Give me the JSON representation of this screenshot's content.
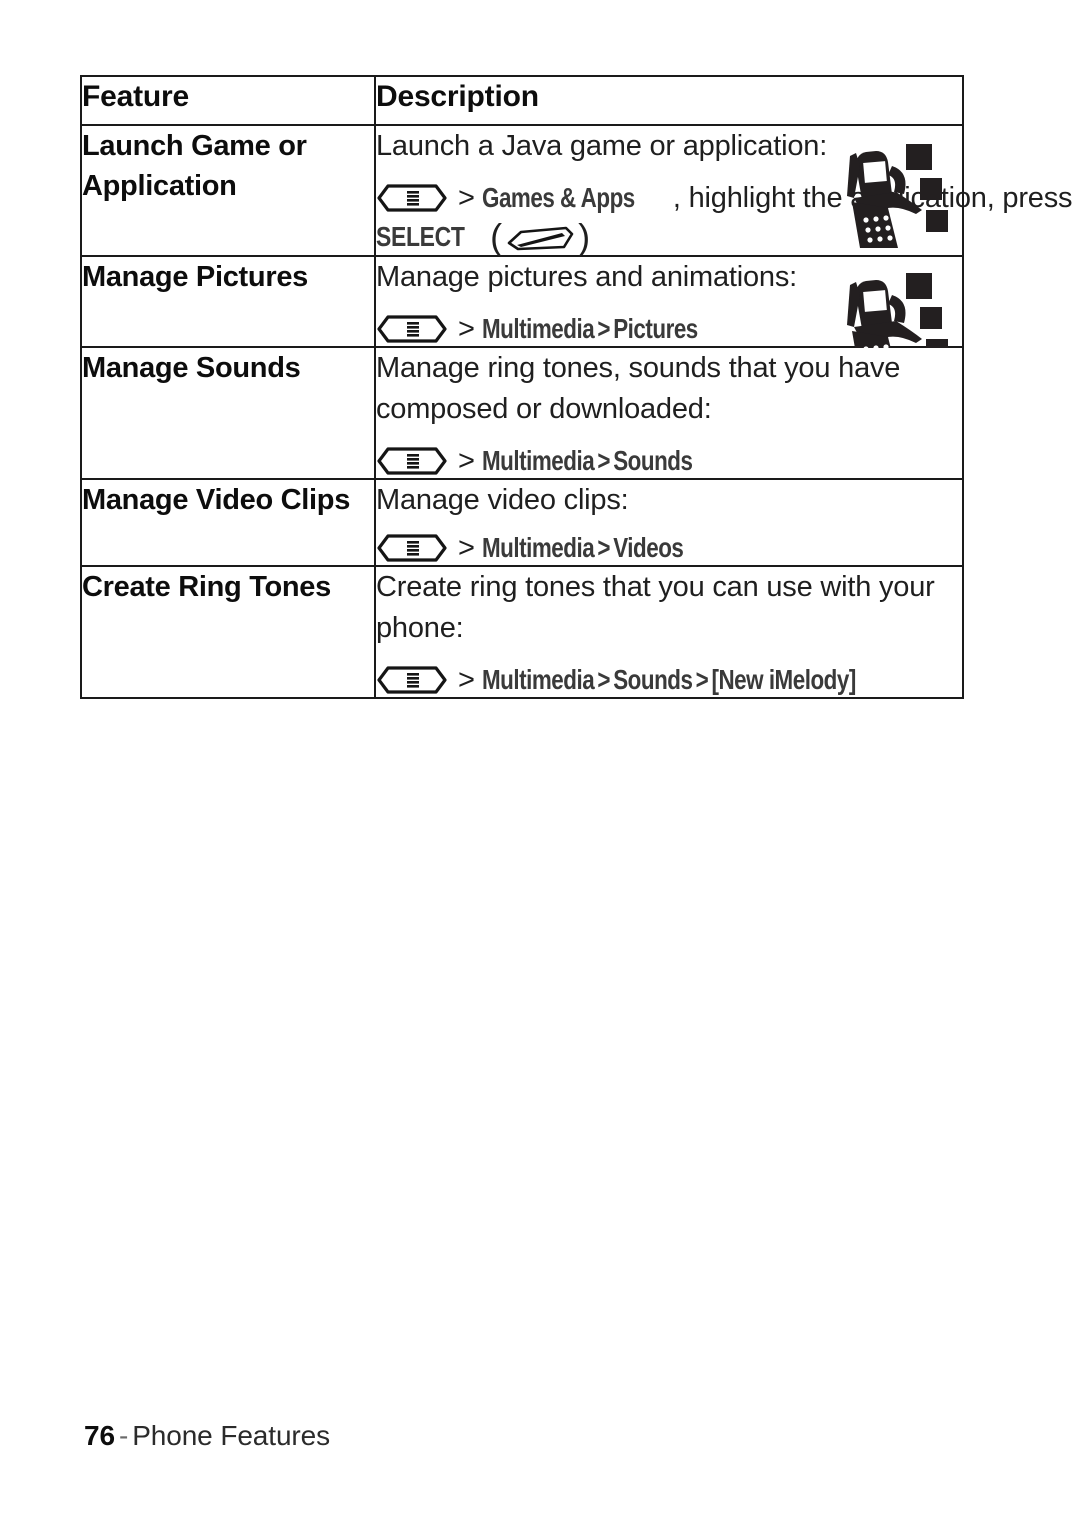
{
  "document": {
    "table": {
      "columns": [
        {
          "header": "Feature"
        },
        {
          "header": "Description"
        }
      ],
      "rows": [
        {
          "feature": "Launch Game or Application",
          "description": "Launch a Java game or application:",
          "nav": {
            "key_icon": "menu-key-icon",
            "separator": ">",
            "path": [
              "Games & Apps"
            ],
            "trailing_text": ", highlight the application, press",
            "press_label": "SELECT",
            "press_key_icon": "soft-key-icon"
          },
          "media_icon": "multimedia-phone-icon"
        },
        {
          "feature": "Manage Pictures",
          "description": "Manage pictures and animations:",
          "nav": {
            "key_icon": "menu-key-icon",
            "separator": ">",
            "path": [
              "Multimedia",
              "Pictures"
            ]
          },
          "media_icon": "multimedia-phone-icon"
        },
        {
          "feature": "Manage Sounds",
          "description": "Manage ring tones, sounds that you have composed or downloaded:",
          "nav": {
            "key_icon": "menu-key-icon",
            "separator": ">",
            "path": [
              "Multimedia",
              "Sounds"
            ]
          }
        },
        {
          "feature": "Manage Video Clips",
          "description": "Manage video clips:",
          "nav": {
            "key_icon": "menu-key-icon",
            "separator": ">",
            "path": [
              "Multimedia",
              "Videos"
            ]
          }
        },
        {
          "feature": "Create Ring Tones",
          "description": "Create ring tones that you can use with your phone:",
          "nav": {
            "key_icon": "menu-key-icon",
            "separator": ">",
            "path": [
              "Multimedia",
              "Sounds",
              "[New iMelody]"
            ]
          }
        }
      ]
    },
    "footer": {
      "page_number": "76",
      "dash": "-",
      "section": "Phone Features"
    },
    "colors": {
      "text": "#1f1f1f",
      "heading": "#0d0d0d",
      "nav_path": "#3a3a3a",
      "border": "#1a1a1a",
      "background": "#ffffff"
    }
  }
}
